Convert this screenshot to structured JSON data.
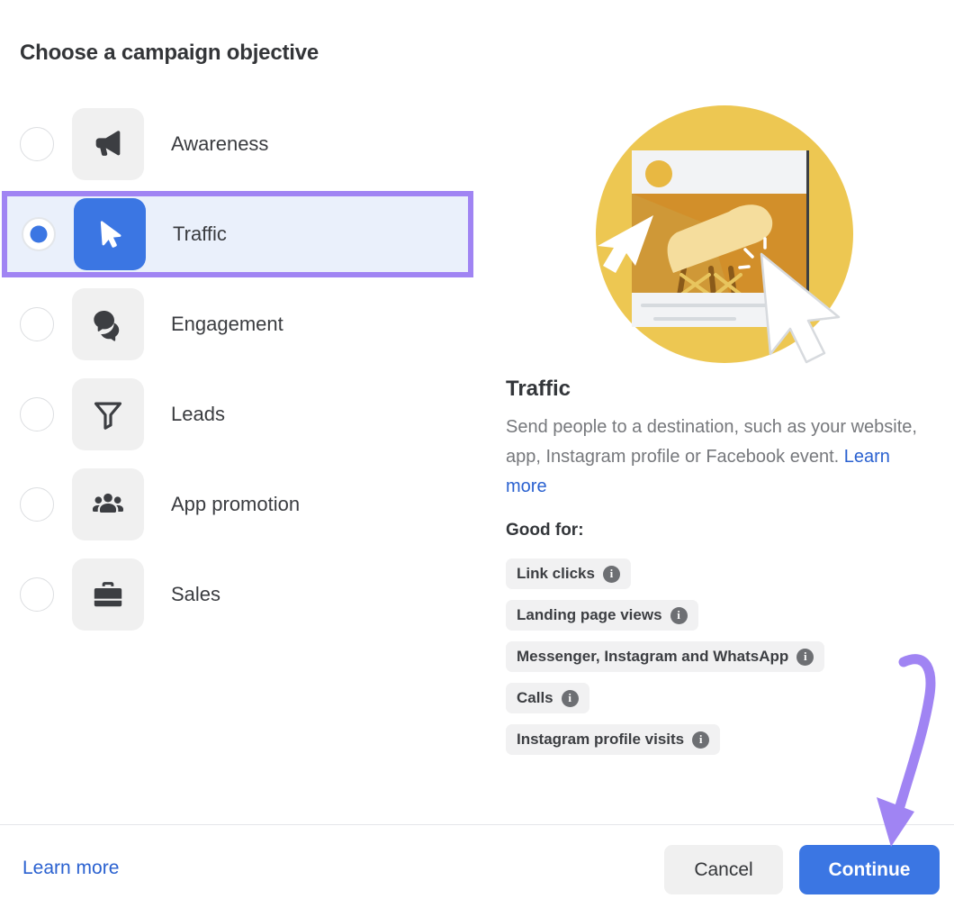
{
  "heading": "Choose a campaign objective",
  "objectives": [
    {
      "label": "Awareness",
      "icon": "megaphone-icon",
      "selected": false
    },
    {
      "label": "Traffic",
      "icon": "cursor-arrow-icon",
      "selected": true
    },
    {
      "label": "Engagement",
      "icon": "chat-bubbles-icon",
      "selected": false
    },
    {
      "label": "Leads",
      "icon": "funnel-icon",
      "selected": false
    },
    {
      "label": "App promotion",
      "icon": "people-group-icon",
      "selected": false
    },
    {
      "label": "Sales",
      "icon": "briefcase-icon",
      "selected": false
    }
  ],
  "details": {
    "title": "Traffic",
    "description": "Send people to a destination, such as your website, app, Instagram profile or Facebook event.",
    "description_link": "Learn more",
    "good_for_label": "Good for:",
    "tags": [
      "Link clicks",
      "Landing page views",
      "Messenger, Instagram and WhatsApp",
      "Calls",
      "Instagram profile visits"
    ],
    "info_glyph": "i",
    "illustration": "traffic-chair-ad-illustration"
  },
  "footer": {
    "learn_more": "Learn more",
    "cancel_label": "Cancel",
    "continue_label": "Continue"
  },
  "colors": {
    "accent_blue": "#3b76e3",
    "link_blue": "#2a61d0",
    "highlight_purple": "#a084f3",
    "selected_row_bg": "#eaf0fb",
    "tile_gray": "#f0f0f0",
    "tag_gray": "#f1f1f2",
    "illustration_yellow": "#edc752"
  },
  "annotation": {
    "arrow": "curved-arrow-pointing-to-continue"
  }
}
